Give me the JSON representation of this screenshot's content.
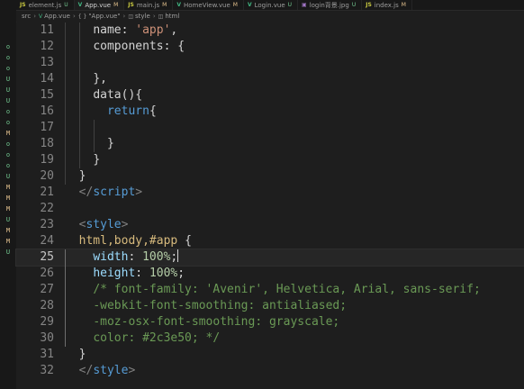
{
  "tabs": [
    {
      "icon": "JS",
      "label": "element.js",
      "status": "U",
      "icon_color": "#cbcb41",
      "status_color": "#73c991",
      "active": false
    },
    {
      "icon": "V",
      "label": "App.vue",
      "status": "M",
      "icon_color": "#41b883",
      "status_color": "#e2c08d",
      "active": true
    },
    {
      "icon": "JS",
      "label": "main.js",
      "status": "M",
      "icon_color": "#cbcb41",
      "status_color": "#e2c08d",
      "active": false
    },
    {
      "icon": "V",
      "label": "HomeView.vue",
      "status": "M",
      "icon_color": "#41b883",
      "status_color": "#e2c08d",
      "active": false
    },
    {
      "icon": "V",
      "label": "Login.vue",
      "status": "U",
      "icon_color": "#41b883",
      "status_color": "#73c991",
      "active": false
    },
    {
      "icon": "▣",
      "label": "login背景.jpg",
      "status": "U",
      "icon_color": "#a074c4",
      "status_color": "#73c991",
      "active": false
    },
    {
      "icon": "JS",
      "label": "index.js",
      "status": "M",
      "icon_color": "#cbcb41",
      "status_color": "#e2c08d",
      "active": false
    }
  ],
  "breadcrumb": {
    "src": "src",
    "file": "App.vue",
    "section": "\"App.vue\"",
    "style": "style",
    "html": "html",
    "section_icon": "{ }",
    "style_icon": "◫",
    "html_icon": "◫"
  },
  "sidebar_marks": [
    {
      "mark": "o",
      "color": "#73c991",
      "row": 0
    },
    {
      "mark": "o",
      "color": "#73c991",
      "row": 1
    },
    {
      "mark": "o",
      "color": "#73c991",
      "row": 2
    },
    {
      "mark": "U",
      "color": "#73c991",
      "row": 3
    },
    {
      "mark": "U",
      "color": "#73c991",
      "row": 4
    },
    {
      "mark": "U",
      "color": "#73c991",
      "row": 5
    },
    {
      "mark": "o",
      "color": "#73c991",
      "row": 6
    },
    {
      "mark": "o",
      "color": "#73c991",
      "row": 7
    },
    {
      "mark": "M",
      "color": "#e2c08d",
      "row": 8
    },
    {
      "mark": "o",
      "color": "#73c991",
      "row": 9
    },
    {
      "mark": "o",
      "color": "#73c991",
      "row": 10
    },
    {
      "mark": "o",
      "color": "#73c991",
      "row": 11
    },
    {
      "mark": "U",
      "color": "#73c991",
      "row": 12
    },
    {
      "mark": "M",
      "color": "#e2c08d",
      "row": 13
    },
    {
      "mark": "M",
      "color": "#e2c08d",
      "row": 14
    },
    {
      "mark": "M",
      "color": "#e2c08d",
      "row": 15
    },
    {
      "mark": "U",
      "color": "#73c991",
      "row": 16
    },
    {
      "mark": "M",
      "color": "#e2c08d",
      "row": 17
    },
    {
      "mark": "M",
      "color": "#e2c08d",
      "row": 18
    },
    {
      "mark": "U",
      "color": "#73c991",
      "row": 19
    }
  ],
  "editor": {
    "current_line": 25,
    "lines": [
      {
        "n": "11",
        "tokens": [
          {
            "t": "    "
          },
          {
            "t": "name",
            "c": "kw-pun"
          },
          {
            "t": ": ",
            "c": "kw-pun"
          },
          {
            "t": "'app'",
            "c": "kw-str"
          },
          {
            "t": ",",
            "c": "kw-pun"
          }
        ]
      },
      {
        "n": "12",
        "tokens": [
          {
            "t": "    "
          },
          {
            "t": "components",
            "c": "kw-pun"
          },
          {
            "t": ": ",
            "c": "kw-pun"
          },
          {
            "t": "{",
            "c": "kw-pun"
          }
        ]
      },
      {
        "n": "13",
        "tokens": []
      },
      {
        "n": "14",
        "tokens": [
          {
            "t": "    "
          },
          {
            "t": "},",
            "c": "kw-pun"
          }
        ]
      },
      {
        "n": "15",
        "tokens": [
          {
            "t": "    "
          },
          {
            "t": "data",
            "c": "kw-pun"
          },
          {
            "t": "(){",
            "c": "kw-pun"
          }
        ]
      },
      {
        "n": "16",
        "tokens": [
          {
            "t": "      "
          },
          {
            "t": "return",
            "c": "kw-tag"
          },
          {
            "t": "{",
            "c": "kw-pun"
          }
        ]
      },
      {
        "n": "17",
        "tokens": []
      },
      {
        "n": "18",
        "tokens": [
          {
            "t": "      "
          },
          {
            "t": "}",
            "c": "kw-pun"
          }
        ]
      },
      {
        "n": "19",
        "tokens": [
          {
            "t": "    "
          },
          {
            "t": "}",
            "c": "kw-pun"
          }
        ]
      },
      {
        "n": "20",
        "tokens": [
          {
            "t": "  "
          },
          {
            "t": "}",
            "c": "kw-pun"
          }
        ]
      },
      {
        "n": "21",
        "tokens": [
          {
            "t": "  "
          },
          {
            "t": "</",
            "c": "kw-brkt"
          },
          {
            "t": "script",
            "c": "kw-tag"
          },
          {
            "t": ">",
            "c": "kw-brkt"
          }
        ]
      },
      {
        "n": "22",
        "tokens": []
      },
      {
        "n": "23",
        "tokens": [
          {
            "t": "  "
          },
          {
            "t": "<",
            "c": "kw-brkt"
          },
          {
            "t": "style",
            "c": "kw-tag"
          },
          {
            "t": ">",
            "c": "kw-brkt"
          }
        ]
      },
      {
        "n": "24",
        "tokens": [
          {
            "t": "  "
          },
          {
            "t": "html,body,#app",
            "c": "kw-sel"
          },
          {
            "t": " "
          },
          {
            "t": "{",
            "c": "kw-pun"
          }
        ]
      },
      {
        "n": "25",
        "tokens": [
          {
            "t": "    "
          },
          {
            "t": "width",
            "c": "kw-prop"
          },
          {
            "t": ": ",
            "c": "kw-pun"
          },
          {
            "t": "100%",
            "c": "kw-num"
          },
          {
            "t": ";",
            "c": "kw-pun"
          },
          {
            "cursor": true
          }
        ]
      },
      {
        "n": "26",
        "tokens": [
          {
            "t": "    "
          },
          {
            "t": "height",
            "c": "kw-prop"
          },
          {
            "t": ": ",
            "c": "kw-pun"
          },
          {
            "t": "100%",
            "c": "kw-num"
          },
          {
            "t": ";",
            "c": "kw-pun"
          }
        ]
      },
      {
        "n": "27",
        "tokens": [
          {
            "t": "    "
          },
          {
            "t": "/* font-family: 'Avenir', Helvetica, Arial, sans-serif;",
            "c": "kw-cmt"
          }
        ]
      },
      {
        "n": "28",
        "tokens": [
          {
            "t": "    "
          },
          {
            "t": "-webkit-font-smoothing: antialiased;",
            "c": "kw-cmt"
          }
        ]
      },
      {
        "n": "29",
        "tokens": [
          {
            "t": "    "
          },
          {
            "t": "-moz-osx-font-smoothing: grayscale;",
            "c": "kw-cmt"
          }
        ]
      },
      {
        "n": "30",
        "tokens": [
          {
            "t": "    "
          },
          {
            "t": "color: #2c3e50; */",
            "c": "kw-cmt"
          }
        ]
      },
      {
        "n": "31",
        "tokens": [
          {
            "t": "  "
          },
          {
            "t": "}",
            "c": "kw-pun"
          }
        ]
      },
      {
        "n": "32",
        "tokens": [
          {
            "t": "  "
          },
          {
            "t": "</",
            "c": "kw-brkt"
          },
          {
            "t": "style",
            "c": "kw-tag"
          },
          {
            "t": ">",
            "c": "kw-brkt"
          }
        ]
      }
    ]
  }
}
